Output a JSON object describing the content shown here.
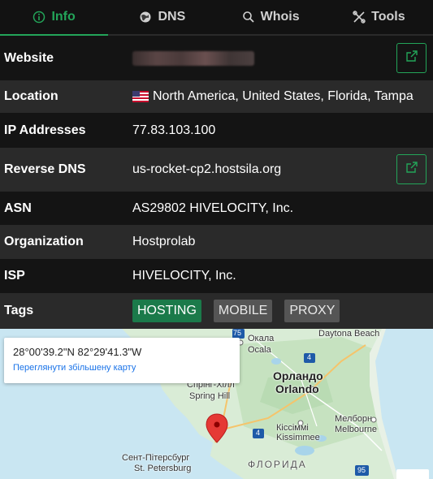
{
  "tabs": [
    {
      "label": "Info",
      "icon": "info-icon",
      "active": true
    },
    {
      "label": "DNS",
      "icon": "globe-icon",
      "active": false
    },
    {
      "label": "Whois",
      "icon": "search-icon",
      "active": false
    },
    {
      "label": "Tools",
      "icon": "tools-icon",
      "active": false
    }
  ],
  "rows": {
    "website": {
      "label": "Website"
    },
    "location": {
      "label": "Location",
      "value": "North America, United States, Florida, Tampa"
    },
    "ip": {
      "label": "IP Addresses",
      "value": "77.83.103.100"
    },
    "reverse_dns": {
      "label": "Reverse DNS",
      "value": "us-rocket-cp2.hostsila.org"
    },
    "asn": {
      "label": "ASN",
      "value": "AS29802 HIVELOCITY, Inc."
    },
    "organization": {
      "label": "Organization",
      "value": "Hostprolab"
    },
    "isp": {
      "label": "ISP",
      "value": "HIVELOCITY, Inc."
    },
    "tags": {
      "label": "Tags",
      "items": [
        "HOSTING",
        "MOBILE",
        "PROXY"
      ]
    }
  },
  "map": {
    "coords": "28°00'39.2\"N 82°29'41.3\"W",
    "link": "Переглянути збільшену карту",
    "labels": {
      "ocala_uk": "Окала",
      "ocala": "Ocala",
      "daytona": "Daytona Beach",
      "orlando_uk": "Орландо",
      "orlando": "Orlando",
      "spring_hill_uk": "Спрінг-Хілл",
      "spring_hill": "Spring Hill",
      "kissimmee_uk": "Кіссіммі",
      "kissimmee": "Kissimmee",
      "melbourne_uk": "Мелборн",
      "melbourne": "Melbourne",
      "st_pete_uk": "Сент-Пітерсбург",
      "st_pete": "St. Petersburg",
      "florida_uk": "ФЛОРИДА",
      "hwy75": "75",
      "hwy4a": "4",
      "hwy4b": "4",
      "hwy95": "95"
    }
  },
  "colors": {
    "accent": "#23a559",
    "tag_hosting": "#1b7a4a",
    "tag_gray": "#555555",
    "row_dark": "#141414",
    "row_light": "#2a2a2a"
  }
}
